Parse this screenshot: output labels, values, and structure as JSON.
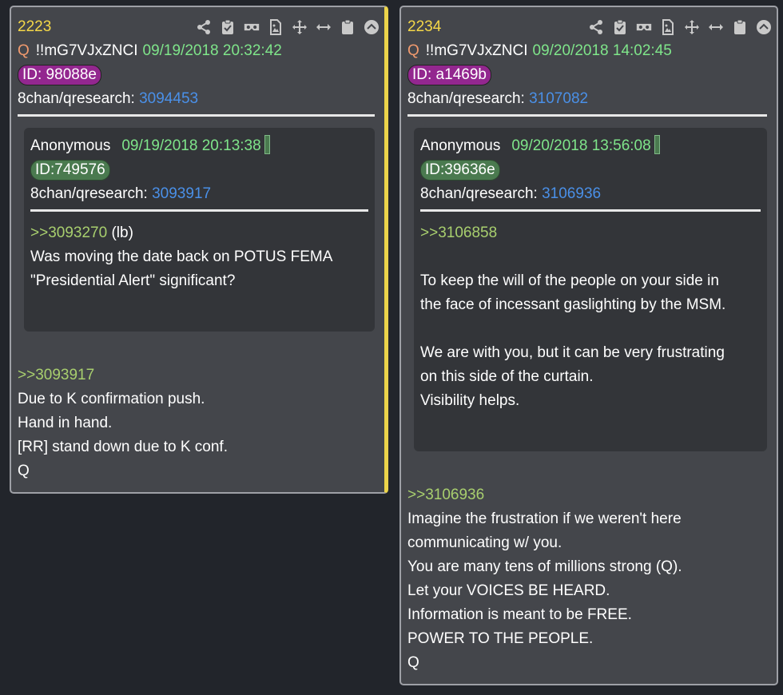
{
  "toolbar_icons": [
    "share-icon",
    "clipboard-check-icon",
    "vr-goggles-icon",
    "file-image-icon",
    "move-icon",
    "arrows-horizontal-icon",
    "clipboard-icon",
    "scroll-top-icon"
  ],
  "colors": {
    "accent_yellow": "#f5d848",
    "date_green": "#7fe58a",
    "link_blue": "#4a90e8",
    "greentext": "#a8cf6e",
    "id_purple": "#93278f"
  },
  "posts": [
    {
      "number": "2223",
      "author": "Q",
      "tripcode": "!!mG7VJxZNCI",
      "date": "09/19/2018 20:32:42",
      "id": "ID: 98088e",
      "board": "8chan/qresearch:",
      "post_link": "3094453",
      "quote": {
        "author": "Anonymous",
        "date": "09/19/2018 20:13:38",
        "id": "ID:749576",
        "board": "8chan/qresearch:",
        "post_link": "3093917",
        "ref": ">>3093270",
        "ref_suffix": " (lb)",
        "lines": [
          "Was moving the date back on POTUS FEMA",
          "\"Presidential Alert\" significant?"
        ]
      },
      "reply_ref": ">>3093917",
      "lines": [
        "Due to K confirmation push.",
        "Hand in hand.",
        "[RR] stand down due to K conf.",
        "Q"
      ]
    },
    {
      "number": "2234",
      "author": "Q",
      "tripcode": "!!mG7VJxZNCI",
      "date": "09/20/2018 14:02:45",
      "id": "ID: a1469b",
      "board": "8chan/qresearch:",
      "post_link": "3107082",
      "quote": {
        "author": "Anonymous",
        "date": "09/20/2018 13:56:08",
        "id": "ID:39636e",
        "board": "8chan/qresearch:",
        "post_link": "3106936",
        "ref": ">>3106858",
        "lines_a": [
          "To keep the will of the people on  your side in",
          "the face of incessant gaslighting by the MSM."
        ],
        "lines_b": [
          "We are with you, but it can be very frustrating",
          "on this side of the curtain.",
          "Visibility helps."
        ]
      },
      "reply_ref": ">>3106936",
      "lines": [
        "Imagine the frustration if we weren't here",
        "communicating w/ you.",
        "You are many tens of millions strong (Q).",
        "Let your VOICES BE HEARD.",
        "Information is meant to be FREE.",
        "POWER TO THE PEOPLE.",
        "Q"
      ]
    }
  ]
}
